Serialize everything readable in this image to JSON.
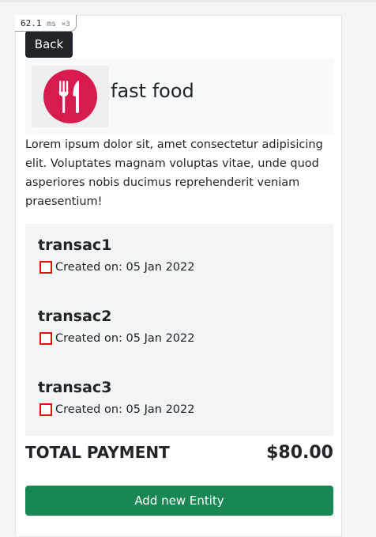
{
  "perf": {
    "value": "62.1",
    "unit": "ms",
    "multiplier": "×3"
  },
  "back_label": "Back",
  "header": {
    "title": "fast food",
    "logo_icon": "fork-knife-icon",
    "logo_color": "#d81b4f"
  },
  "description": "Lorem ipsum dolor sit, amet consectetur adipisicing elit. Voluptates magnam voluptas vitae, unde quod asperiores nobis ducimus reprehenderit veniam praesentium!",
  "transactions": [
    {
      "name": "transac1",
      "created": "Created on: 05 Jan 2022"
    },
    {
      "name": "transac2",
      "created": "Created on: 05 Jan 2022"
    },
    {
      "name": "transac3",
      "created": "Created on: 05 Jan 2022"
    }
  ],
  "total": {
    "label": "TOTAL PAYMENT",
    "amount": "$80.00"
  },
  "add_label": "Add new Entity",
  "colors": {
    "primary_dark": "#212529",
    "success": "#198754",
    "check_border": "#e01010"
  }
}
